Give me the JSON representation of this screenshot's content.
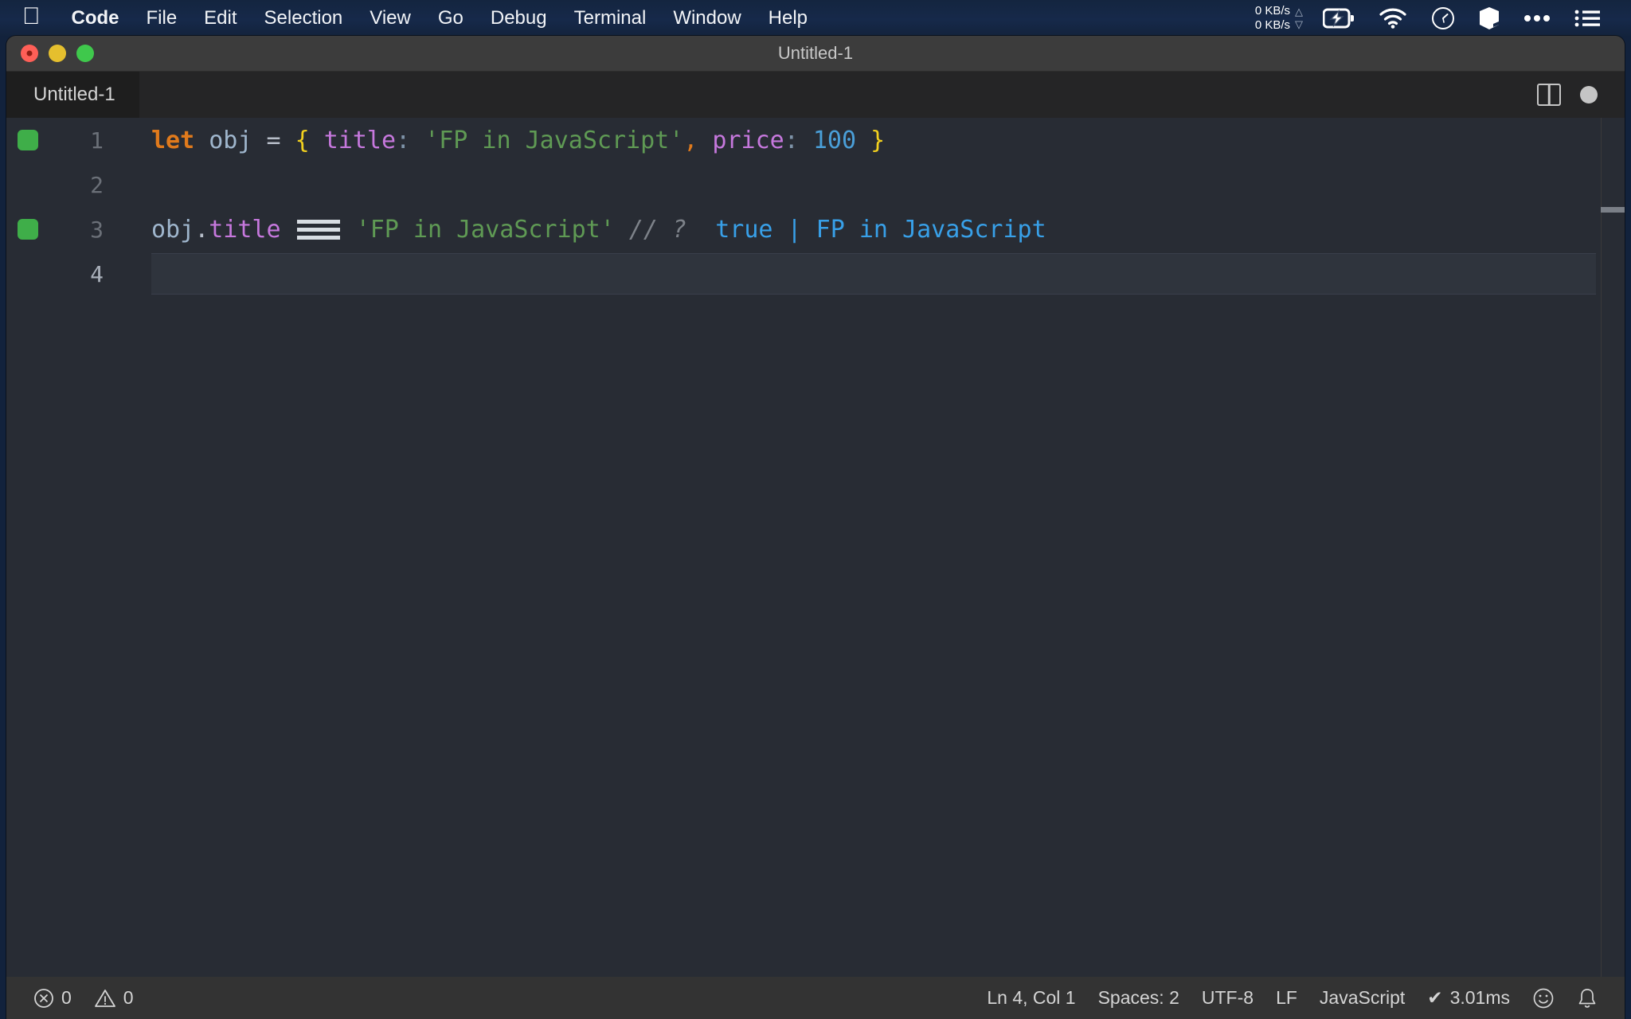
{
  "menubar": {
    "apple_icon": "apple-logo-icon",
    "items": [
      {
        "label": "Code",
        "bold": true
      },
      {
        "label": "File",
        "bold": false
      },
      {
        "label": "Edit",
        "bold": false
      },
      {
        "label": "Selection",
        "bold": false
      },
      {
        "label": "View",
        "bold": false
      },
      {
        "label": "Go",
        "bold": false
      },
      {
        "label": "Debug",
        "bold": false
      },
      {
        "label": "Terminal",
        "bold": false
      },
      {
        "label": "Window",
        "bold": false
      },
      {
        "label": "Help",
        "bold": false
      }
    ],
    "network": {
      "upload": "0 KB/s",
      "download": "0 KB/s",
      "up_arrow": "△",
      "down_arrow": "▽"
    },
    "icons": [
      "battery-charging-icon",
      "wifi-icon",
      "clock-icon",
      "cube-icon",
      "ellipsis-icon",
      "list-menu-icon"
    ]
  },
  "window": {
    "title": "Untitled-1",
    "traffic_lights": [
      "close",
      "minimize",
      "zoom"
    ]
  },
  "tabbar": {
    "tab_label": "Untitled-1",
    "split_editor_icon": "split-editor-icon",
    "dirty_indicator": "unsaved-dot-icon"
  },
  "editor": {
    "language": "JavaScript",
    "lines": [
      {
        "number": "1",
        "quokka": true,
        "current": false,
        "tokens": [
          {
            "text": "let",
            "cls": "t-keyword"
          },
          {
            "text": " ",
            "cls": "t-var"
          },
          {
            "text": "obj",
            "cls": "t-var"
          },
          {
            "text": " ",
            "cls": "t-var"
          },
          {
            "text": "=",
            "cls": "t-op"
          },
          {
            "text": " ",
            "cls": "t-op"
          },
          {
            "text": "{",
            "cls": "t-brace"
          },
          {
            "text": " ",
            "cls": "t-var"
          },
          {
            "text": "title",
            "cls": "t-prop"
          },
          {
            "text": ":",
            "cls": "t-colon"
          },
          {
            "text": " ",
            "cls": "t-var"
          },
          {
            "text": "'FP in JavaScript'",
            "cls": "t-string"
          },
          {
            "text": ",",
            "cls": "t-comma"
          },
          {
            "text": " ",
            "cls": "t-var"
          },
          {
            "text": "price",
            "cls": "t-prop"
          },
          {
            "text": ":",
            "cls": "t-colon"
          },
          {
            "text": " ",
            "cls": "t-var"
          },
          {
            "text": "100",
            "cls": "t-number"
          },
          {
            "text": " ",
            "cls": "t-var"
          },
          {
            "text": "}",
            "cls": "t-brace"
          }
        ]
      },
      {
        "number": "2",
        "quokka": false,
        "current": false,
        "tokens": []
      },
      {
        "number": "3",
        "quokka": true,
        "current": false,
        "tokens": [
          {
            "text": "obj",
            "cls": "t-var"
          },
          {
            "text": ".",
            "cls": "t-op"
          },
          {
            "text": "title",
            "cls": "t-prop"
          },
          {
            "text": " ",
            "cls": "t-var"
          },
          {
            "text": "===",
            "cls": "t-op",
            "ligature": "eqeqeq"
          },
          {
            "text": " ",
            "cls": "t-var"
          },
          {
            "text": "'FP in JavaScript'",
            "cls": "t-string"
          },
          {
            "text": " ",
            "cls": "t-var"
          },
          {
            "text": "// ?",
            "cls": "t-comment"
          },
          {
            "text": "  ",
            "cls": "t-var"
          },
          {
            "text": "true",
            "cls": "t-result"
          },
          {
            "text": " ",
            "cls": "t-var"
          },
          {
            "text": "|",
            "cls": "t-pipe"
          },
          {
            "text": " ",
            "cls": "t-var"
          },
          {
            "text": "FP in JavaScript",
            "cls": "t-result"
          }
        ]
      },
      {
        "number": "4",
        "quokka": false,
        "current": true,
        "tokens": []
      }
    ]
  },
  "statusbar": {
    "errors": {
      "icon": "error-circle-icon",
      "count": "0"
    },
    "warnings": {
      "icon": "warning-triangle-icon",
      "count": "0"
    },
    "cursor_position": "Ln 4, Col 1",
    "indentation": "Spaces: 2",
    "encoding": "UTF-8",
    "line_ending": "LF",
    "language_mode": "JavaScript",
    "quokka_timing": "3.01ms",
    "quokka_check": "✔",
    "feedback_icon": "smiley-icon",
    "notifications_icon": "bell-icon"
  },
  "colors": {
    "menubar_bg": "#16294a",
    "titlebar_bg": "#3c3c3c",
    "tabbar_bg": "#252526",
    "editor_bg": "#282c34",
    "statusbar_bg": "#333333",
    "quokka_green": "#3fae49",
    "accent_blue": "#38a0e8",
    "string_green": "#5f9a54",
    "keyword_orange": "#e07a1c",
    "property_purple": "#c678dd",
    "brace_yellow": "#f2d01e",
    "number_blue": "#4a9fd8"
  }
}
